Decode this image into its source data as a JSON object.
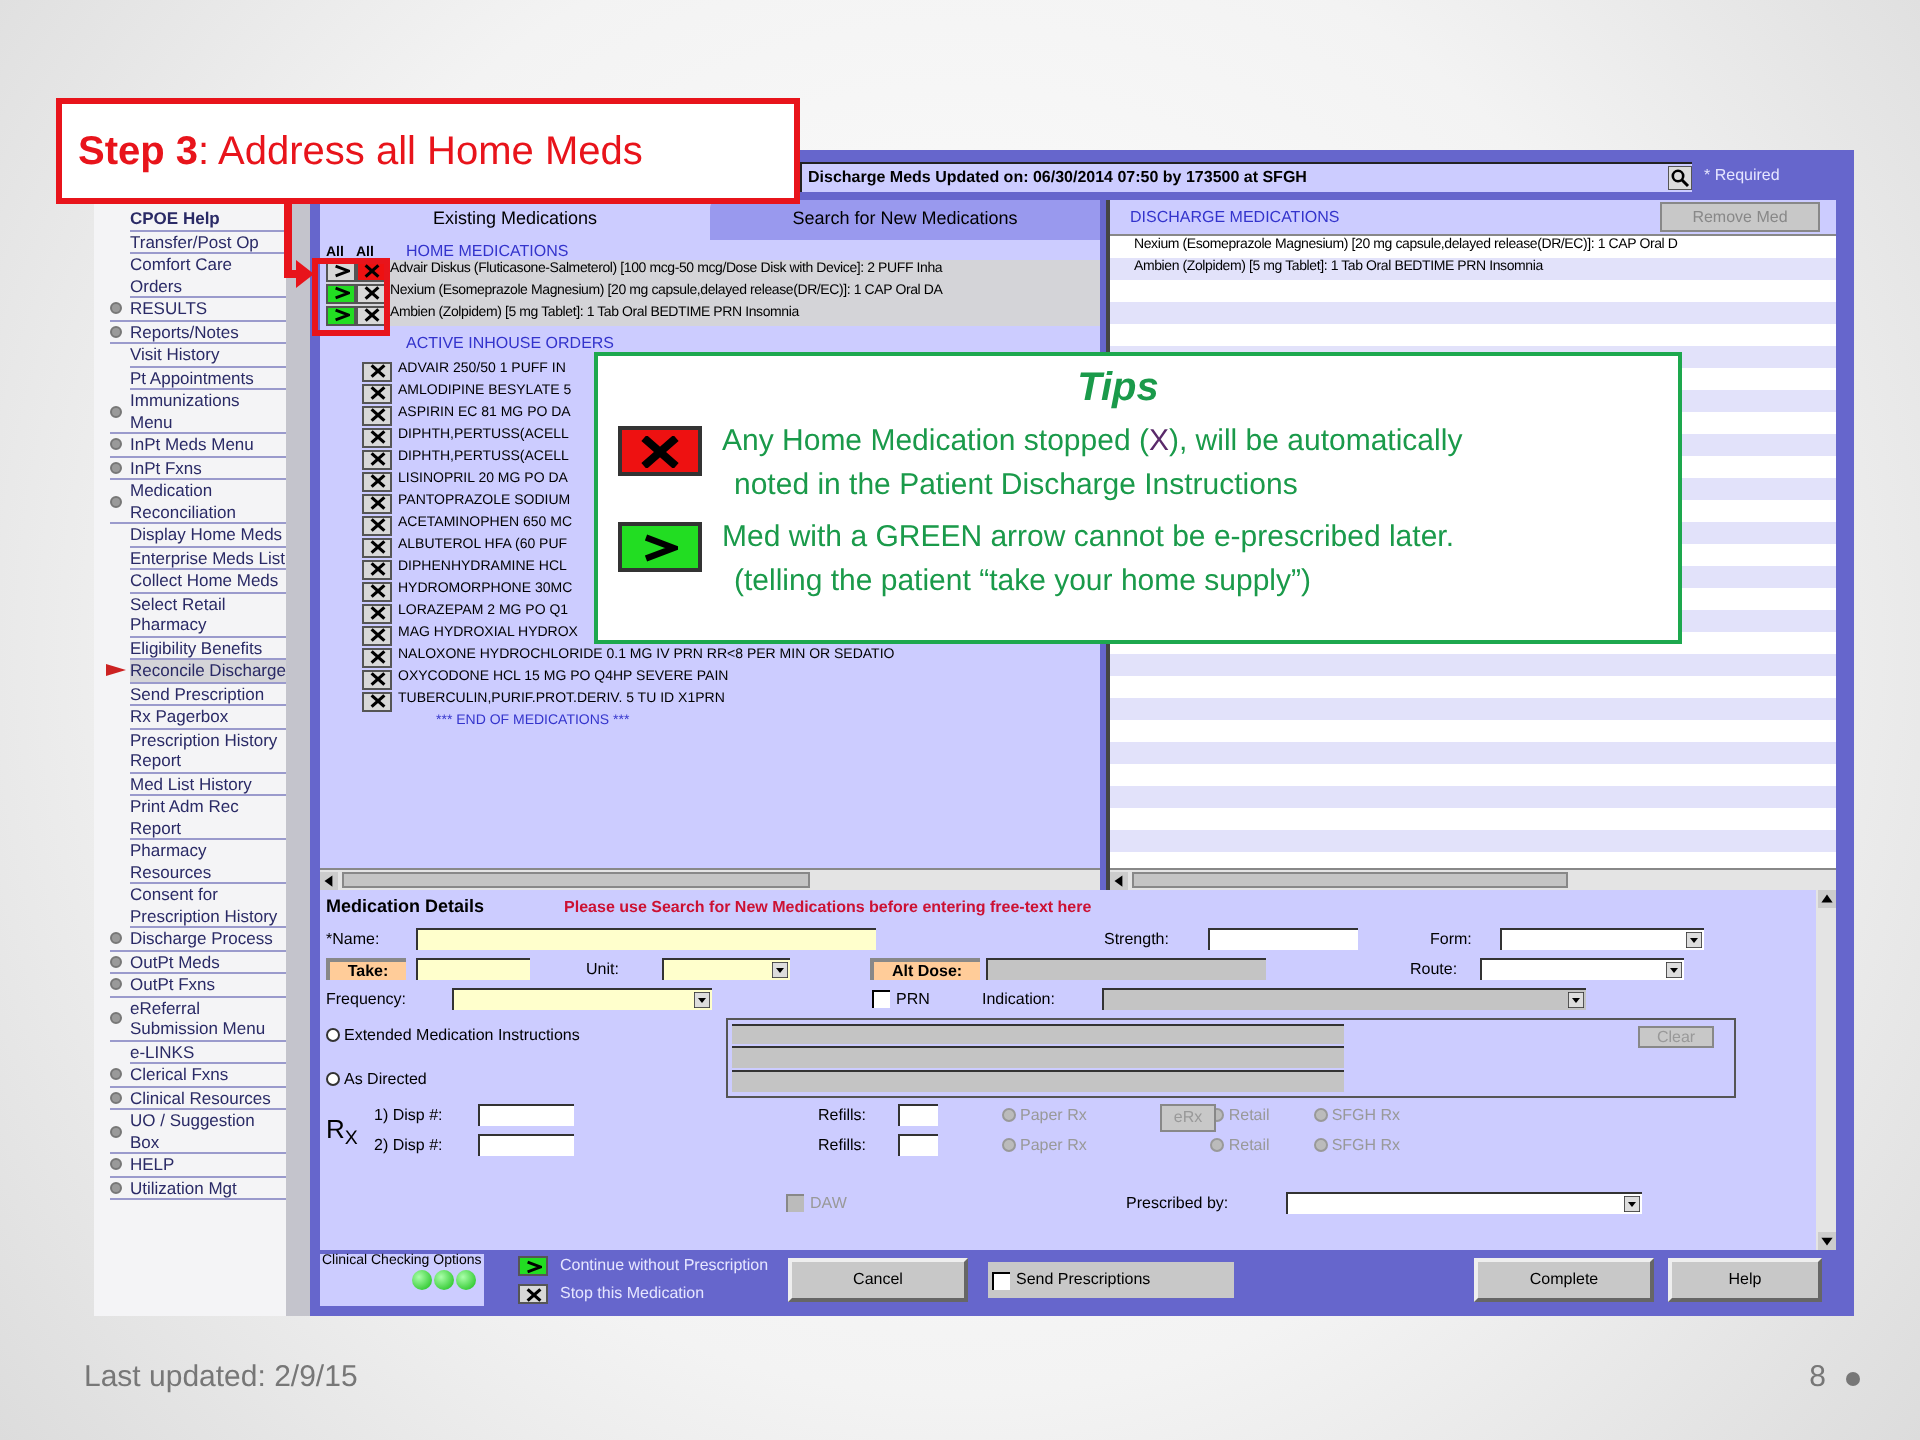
{
  "slide": {
    "callout": "**Step 3**: Address all Home Meds",
    "footer": "Last updated: 2/9/15",
    "page_number": "8"
  },
  "sidebar": {
    "items": [
      {
        "label": "CPOE Help",
        "kind": "heading"
      },
      {
        "label": "Transfer/Post Op",
        "kind": "plain"
      },
      {
        "label": "Comfort Care Orders",
        "kind": "plain"
      },
      {
        "label": "RESULTS",
        "kind": "bullet"
      },
      {
        "label": "Reports/Notes",
        "kind": "bullet"
      },
      {
        "label": "Visit History",
        "kind": "plain"
      },
      {
        "label": "Pt Appointments",
        "kind": "plain"
      },
      {
        "label": "Immunizations Menu",
        "kind": "bullet"
      },
      {
        "label": "InPt Meds Menu",
        "kind": "bullet"
      },
      {
        "label": "InPt Fxns",
        "kind": "bullet"
      },
      {
        "label": "Medication Reconciliation",
        "kind": "bullet",
        "children": [
          {
            "label": "Display Home Meds",
            "selected": false
          },
          {
            "label": "Enterprise Meds List",
            "selected": false
          },
          {
            "label": "Collect Home Meds",
            "selected": false
          },
          {
            "label": "Select Retail Pharmacy",
            "selected": false
          },
          {
            "label": "Eligibility Benefits",
            "selected": false
          },
          {
            "label": "Reconcile Discharge",
            "selected": true
          },
          {
            "label": "Send Prescription",
            "selected": false
          },
          {
            "label": "Rx Pagerbox",
            "selected": false
          },
          {
            "label": "Prescription History Report",
            "selected": false
          },
          {
            "label": "Med List History",
            "selected": false
          },
          {
            "label": "Print Adm Rec Report",
            "selected": false
          },
          {
            "label": "Pharmacy Resources",
            "selected": false
          },
          {
            "label": "Consent for Prescription History",
            "selected": false
          }
        ]
      },
      {
        "label": "Discharge Process",
        "kind": "bullet"
      },
      {
        "label": "OutPt Meds",
        "kind": "bullet"
      },
      {
        "label": "OutPt Fxns",
        "kind": "bullet"
      },
      {
        "label": "eReferral Submission Menu",
        "kind": "bullet"
      },
      {
        "label": "e-LINKS",
        "kind": "plain"
      },
      {
        "label": "Clerical Fxns",
        "kind": "bullet"
      },
      {
        "label": "Clinical Resources",
        "kind": "bullet"
      },
      {
        "label": "UO / Suggestion Box",
        "kind": "bullet"
      },
      {
        "label": "HELP",
        "kind": "bullet"
      },
      {
        "label": "Utilization Mgt",
        "kind": "bullet"
      }
    ]
  },
  "header": {
    "title": "Discharge Meds Updated on: 06/30/2014 07:50 by 173500 at SFGH",
    "required_note": "* Required"
  },
  "tabs": [
    {
      "label": "Existing Medications",
      "selected": true
    },
    {
      "label": "Search for New Medications",
      "selected": false
    }
  ],
  "existing": {
    "column_headers": [
      "All",
      "All"
    ],
    "home_heading": "HOME MEDICATIONS",
    "home_meds": [
      {
        "text": "Advair Diskus (Fluticasone-Salmeterol) [100 mcg-50 mcg/Dose Disk with Device]: 2 PUFF Inha",
        "continue": false,
        "stop": true
      },
      {
        "text": "Nexium (Esomeprazole Magnesium) [20 mg capsule,delayed release(DR/EC)]: 1 CAP Oral DA",
        "continue": true,
        "stop": false
      },
      {
        "text": "Ambien (Zolpidem) [5 mg Tablet]: 1 Tab Oral BEDTIME PRN Insomnia",
        "continue": true,
        "stop": false
      }
    ],
    "inhouse_heading": "ACTIVE INHOUSE ORDERS",
    "inhouse_orders": [
      "ADVAIR 250/50 1 PUFF IN",
      "AMLODIPINE BESYLATE 5",
      "ASPIRIN EC 81 MG PO DA",
      "DIPHTH,PERTUSS(ACELL",
      "DIPHTH,PERTUSS(ACELL",
      "LISINOPRIL 20 MG PO DA",
      "PANTOPRAZOLE SODIUM",
      "ACETAMINOPHEN 650 MC",
      "ALBUTEROL HFA (60 PUF",
      "DIPHENHYDRAMINE HCL",
      "HYDROMORPHONE 30MC",
      "LORAZEPAM 2 MG PO Q1",
      "MAG HYDROXIAL HYDROX",
      "NALOXONE HYDROCHLORIDE 0.1 MG IV PRN RR<8 PER MIN OR SEDATIO",
      "OXYCODONE HCL 15 MG PO Q4HP SEVERE PAIN",
      "TUBERCULIN,PURIF.PROT.DERIV. 5 TU ID X1PRN"
    ],
    "end_note": "*** END OF MEDICATIONS ***"
  },
  "discharge": {
    "heading": "DISCHARGE MEDICATIONS",
    "remove_button": {
      "label": "Remove Med",
      "disabled": true
    },
    "rows": [
      "Nexium (Esomeprazole Magnesium) [20 mg capsule,delayed release(DR/EC)]: 1 CAP  Oral D",
      "Ambien (Zolpidem) [5 mg Tablet]: 1 Tab  Oral BEDTIME PRN Insomnia"
    ]
  },
  "tips": {
    "title": "Tips",
    "items": [
      {
        "kind": "stop",
        "lines": [
          [
            {
              "text": "Any Home Medication stopped (",
              "accent": false
            },
            {
              "text": "X",
              "accent": true
            },
            {
              "text": "), will be automatically",
              "accent": false
            }
          ],
          [
            {
              "text": "noted in the Patient Discharge Instructions",
              "accent": false
            }
          ]
        ]
      },
      {
        "kind": "continue",
        "lines": [
          [
            {
              "text": "Med with a GREEN arrow cannot be e-prescribed later.",
              "accent": false
            }
          ],
          [
            {
              "text": "(telling the patient “take your home supply”)",
              "accent": false
            }
          ]
        ]
      }
    ]
  },
  "details": {
    "title": "Medication Details",
    "warning": "Please use Search for New Medications before entering free-text here",
    "name_label": "*Name:",
    "strength_label": "Strength:",
    "form_label": "Form:",
    "take_label": "Take:",
    "unit_label": "Unit:",
    "alt_dose_label": "Alt Dose:",
    "route_label": "Route:",
    "frequency_label": "Frequency:",
    "prn": {
      "label": "PRN",
      "checked": false
    },
    "indication_label": "Indication:",
    "instructions": [
      {
        "label": "Extended Medication Instructions",
        "selected": false
      },
      {
        "label": "As Directed",
        "selected": false
      }
    ],
    "clear_button": {
      "label": "Clear",
      "disabled": true
    },
    "rx_symbol": "R$_{X}$",
    "dispense_rows": [
      {
        "disp_label": "1) Disp #:",
        "refills_label": "Refills:",
        "options": [
          {
            "label": "Paper Rx",
            "selected": false,
            "disabled": true
          },
          {
            "label": "Retail",
            "selected": false,
            "disabled": true
          },
          {
            "label": "SFGH Rx",
            "selected": false,
            "disabled": true
          }
        ]
      },
      {
        "disp_label": "2) Disp #:",
        "refills_label": "Refills:",
        "options": [
          {
            "label": "Paper Rx",
            "selected": false,
            "disabled": true
          },
          {
            "label": "Retail",
            "selected": false,
            "disabled": true
          },
          {
            "label": "SFGH Rx",
            "selected": false,
            "disabled": true
          }
        ]
      }
    ],
    "erx_button": {
      "label": "eRx",
      "disabled": true
    },
    "daw": {
      "label": "DAW",
      "checked": false,
      "disabled": true
    },
    "prescribed_by_label": "Prescribed by:"
  },
  "bottom_bar": {
    "clinical_label": "Clinical Checking Options",
    "options": [
      {
        "kind": "continue",
        "label": "Continue without Prescription"
      },
      {
        "kind": "stop",
        "label": "Stop this Medication"
      }
    ],
    "cancel": "Cancel",
    "send": {
      "label": "Send Prescriptions",
      "checked": false
    },
    "complete": "Complete",
    "help": "Help"
  }
}
